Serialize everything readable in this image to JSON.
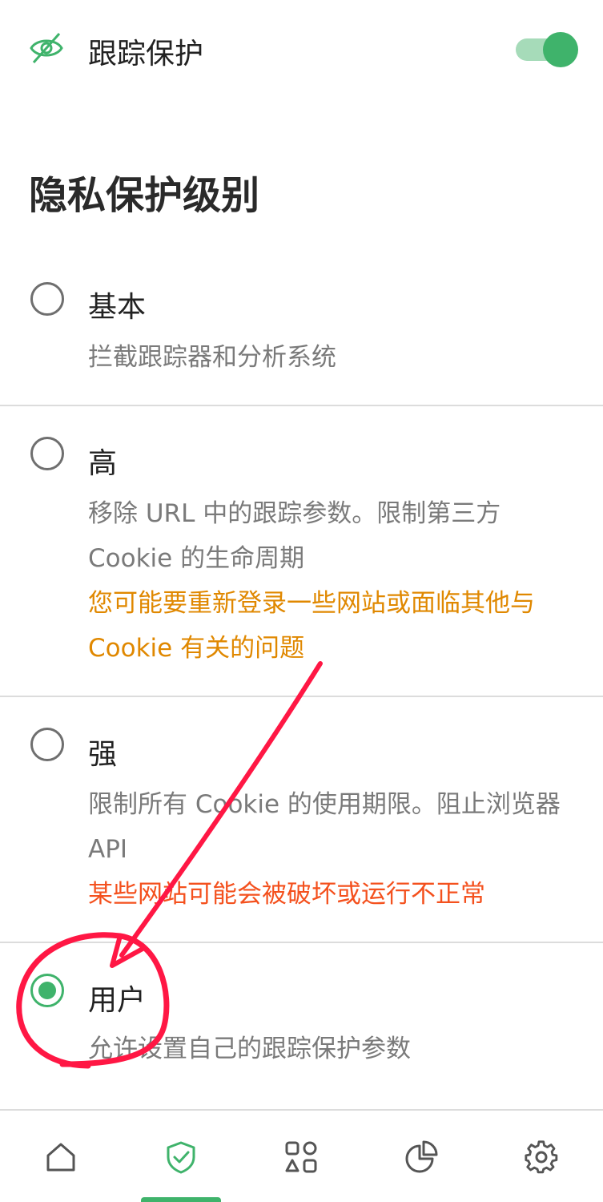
{
  "tracking": {
    "label": "跟踪保护",
    "icon": "eye-off-icon",
    "enabled": true
  },
  "section": {
    "title": "隐私保护级别"
  },
  "options": [
    {
      "title": "基本",
      "description": "拦截跟踪器和分析系统",
      "warning": "",
      "selected": false
    },
    {
      "title": "高",
      "description": "移除 URL 中的跟踪参数。限制第三方 Cookie 的生命周期",
      "warning": "您可能要重新登录一些网站或面临其他与 Cookie 有关的问题",
      "selected": false
    },
    {
      "title": "强",
      "description": "限制所有 Cookie 的使用期限。阻止浏览器 API",
      "warning": "某些网站可能会被破坏或运行不正常",
      "selected": false
    },
    {
      "title": "用户",
      "description": "允许设置自己的跟踪保护参数",
      "warning": "",
      "selected": true
    }
  ],
  "nav": {
    "items": [
      "home-icon",
      "shield-check-icon",
      "apps-icon",
      "stats-icon",
      "settings-icon"
    ],
    "active": "shield-check-icon"
  },
  "colors": {
    "accent": "#3fb36b",
    "warning_orange": "#e08800",
    "warning_red": "#f4511e",
    "annotation": "#ff1744"
  }
}
